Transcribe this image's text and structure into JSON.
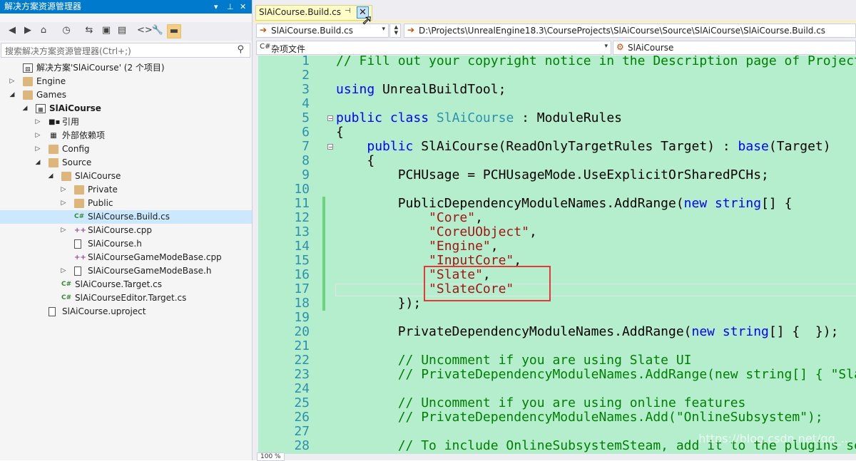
{
  "solution_explorer": {
    "title": "解决方案资源管理器",
    "title_controls": [
      "▾",
      "⊥",
      "✕"
    ],
    "toolbar_icons": [
      "back-icon",
      "forward-icon",
      "home-icon",
      "history-icon",
      "sync-icon",
      "collapse-icon",
      "show-all-icon",
      "code-icon",
      "wrench-icon",
      "preview-icon"
    ],
    "toolbar_glyphs": [
      "◀",
      "▶",
      "⌂",
      "◷",
      "⇆",
      "▣",
      "▤",
      "<>",
      "🔧",
      "▬"
    ],
    "search_placeholder": "搜索解决方案资源管理器(Ctrl+;)",
    "tree": [
      {
        "label": "解决方案'SlAiCourse' (2 个项目)",
        "depth": 0,
        "arrow": "",
        "icon": "solution"
      },
      {
        "label": "Engine",
        "depth": 0,
        "arrow": "▷",
        "icon": "folder"
      },
      {
        "label": "Games",
        "depth": 0,
        "arrow": "◢",
        "icon": "folder"
      },
      {
        "label": "SlAiCourse",
        "depth": 1,
        "arrow": "◢",
        "icon": "project",
        "bold": true
      },
      {
        "label": "引用",
        "depth": 2,
        "arrow": "▷",
        "icon": "references"
      },
      {
        "label": "外部依赖项",
        "depth": 2,
        "arrow": "▷",
        "icon": "external"
      },
      {
        "label": "Config",
        "depth": 2,
        "arrow": "▷",
        "icon": "folder"
      },
      {
        "label": "Source",
        "depth": 2,
        "arrow": "◢",
        "icon": "folder"
      },
      {
        "label": "SlAiCourse",
        "depth": 3,
        "arrow": "◢",
        "icon": "folder"
      },
      {
        "label": "Private",
        "depth": 4,
        "arrow": "▷",
        "icon": "folder"
      },
      {
        "label": "Public",
        "depth": 4,
        "arrow": "▷",
        "icon": "folder"
      },
      {
        "label": "SlAiCourse.Build.cs",
        "depth": 4,
        "arrow": "",
        "icon": "cs",
        "selected": true
      },
      {
        "label": "SlAiCourse.cpp",
        "depth": 4,
        "arrow": "▷",
        "icon": "cpp"
      },
      {
        "label": "SlAiCourse.h",
        "depth": 4,
        "arrow": "",
        "icon": "h"
      },
      {
        "label": "SlAiCourseGameModeBase.cpp",
        "depth": 4,
        "arrow": "",
        "icon": "cpp"
      },
      {
        "label": "SlAiCourseGameModeBase.h",
        "depth": 4,
        "arrow": "▷",
        "icon": "h"
      },
      {
        "label": "SlAiCourse.Target.cs",
        "depth": 3,
        "arrow": "",
        "icon": "cs"
      },
      {
        "label": "SlAiCourseEditor.Target.cs",
        "depth": 3,
        "arrow": "",
        "icon": "cs"
      },
      {
        "label": "SlAiCourse.uproject",
        "depth": 2,
        "arrow": "",
        "icon": "h"
      }
    ]
  },
  "editor": {
    "tab_label": "SlAiCourse.Build.cs",
    "tab_pin": "⊣",
    "tab_close": "✕",
    "file_dropdown": "SlAiCourse.Build.cs",
    "path_dropdown": "D:\\Projects\\UnrealEngine18.3\\CourseProjects\\SlAiCourse\\Source\\SlAiCourse\\SlAiCourse.Build.cs",
    "scope_dropdown": "杂项文件",
    "member_dropdown": "SlAiCourse",
    "zoom": "100 %",
    "watermark": "https://blog.csdn.net/qq_..."
  },
  "code_lines": [
    {
      "n": "1",
      "segs": [
        [
          "cmt",
          "// Fill out your copyright notice in the Description page of Project Settings."
        ]
      ]
    },
    {
      "n": "2",
      "segs": []
    },
    {
      "n": "3",
      "segs": [
        [
          "kw",
          "using"
        ],
        [
          "",
          " UnrealBuildTool;"
        ]
      ]
    },
    {
      "n": "4",
      "segs": []
    },
    {
      "n": "5",
      "segs": [
        [
          "kw",
          "public"
        ],
        [
          "",
          " "
        ],
        [
          "kw",
          "class"
        ],
        [
          "",
          " "
        ],
        [
          "ty",
          "SlAiCourse"
        ],
        [
          "",
          " : ModuleRules"
        ]
      ],
      "fold": "−"
    },
    {
      "n": "6",
      "segs": [
        [
          "",
          "{"
        ]
      ]
    },
    {
      "n": "7",
      "segs": [
        [
          "",
          "    "
        ],
        [
          "kw",
          "public"
        ],
        [
          "",
          " SlAiCourse(ReadOnlyTargetRules Target) : "
        ],
        [
          "kw",
          "base"
        ],
        [
          "",
          "(Target)"
        ]
      ],
      "fold": "−"
    },
    {
      "n": "8",
      "segs": [
        [
          "",
          "    {"
        ]
      ]
    },
    {
      "n": "9",
      "segs": [
        [
          "",
          "        PCHUsage = PCHUsageMode.UseExplicitOrSharedPCHs;"
        ]
      ]
    },
    {
      "n": "10",
      "segs": []
    },
    {
      "n": "11",
      "segs": [
        [
          "",
          "        PublicDependencyModuleNames.AddRange("
        ],
        [
          "kw",
          "new"
        ],
        [
          "",
          " "
        ],
        [
          "kw",
          "string"
        ],
        [
          "",
          "[] {"
        ]
      ],
      "changed": true
    },
    {
      "n": "12",
      "segs": [
        [
          "",
          "            "
        ],
        [
          "str",
          "\"Core\""
        ],
        [
          "",
          ","
        ]
      ],
      "changed": true
    },
    {
      "n": "13",
      "segs": [
        [
          "",
          "            "
        ],
        [
          "str",
          "\"CoreUObject\""
        ],
        [
          "",
          ","
        ]
      ],
      "changed": true
    },
    {
      "n": "14",
      "segs": [
        [
          "",
          "            "
        ],
        [
          "str",
          "\"Engine\""
        ],
        [
          "",
          ","
        ]
      ],
      "changed": true
    },
    {
      "n": "15",
      "segs": [
        [
          "",
          "            "
        ],
        [
          "str",
          "\"InputCore\""
        ],
        [
          "",
          ","
        ]
      ],
      "changed": true
    },
    {
      "n": "16",
      "segs": [
        [
          "",
          "            "
        ],
        [
          "str",
          "\"Slate\""
        ],
        [
          "",
          ","
        ]
      ],
      "changed": true
    },
    {
      "n": "17",
      "segs": [
        [
          "",
          "            "
        ],
        [
          "str",
          "\"SlateCore\""
        ]
      ],
      "changed": true
    },
    {
      "n": "18",
      "segs": [
        [
          "",
          "        });"
        ]
      ],
      "changed": true
    },
    {
      "n": "19",
      "segs": []
    },
    {
      "n": "20",
      "segs": [
        [
          "",
          "        PrivateDependencyModuleNames.AddRange("
        ],
        [
          "kw",
          "new"
        ],
        [
          "",
          " "
        ],
        [
          "kw",
          "string"
        ],
        [
          "",
          "[] {  });"
        ]
      ]
    },
    {
      "n": "21",
      "segs": []
    },
    {
      "n": "22",
      "segs": [
        [
          "",
          "        "
        ],
        [
          "cmt",
          "// Uncomment if you are using Slate UI"
        ]
      ]
    },
    {
      "n": "23",
      "segs": [
        [
          "",
          "        "
        ],
        [
          "cmt",
          "// PrivateDependencyModuleNames.AddRange(new string[] { \"Slate\", \"SlateCore\" });"
        ]
      ]
    },
    {
      "n": "24",
      "segs": []
    },
    {
      "n": "25",
      "segs": [
        [
          "",
          "        "
        ],
        [
          "cmt",
          "// Uncomment if you are using online features"
        ]
      ]
    },
    {
      "n": "26",
      "segs": [
        [
          "",
          "        "
        ],
        [
          "cmt",
          "// PrivateDependencyModuleNames.Add(\"OnlineSubsystem\");"
        ]
      ]
    },
    {
      "n": "27",
      "segs": []
    },
    {
      "n": "28",
      "segs": [
        [
          "",
          "        "
        ],
        [
          "cmt",
          "// To include OnlineSubsystemSteam, add it to the plugins section"
        ]
      ]
    }
  ]
}
